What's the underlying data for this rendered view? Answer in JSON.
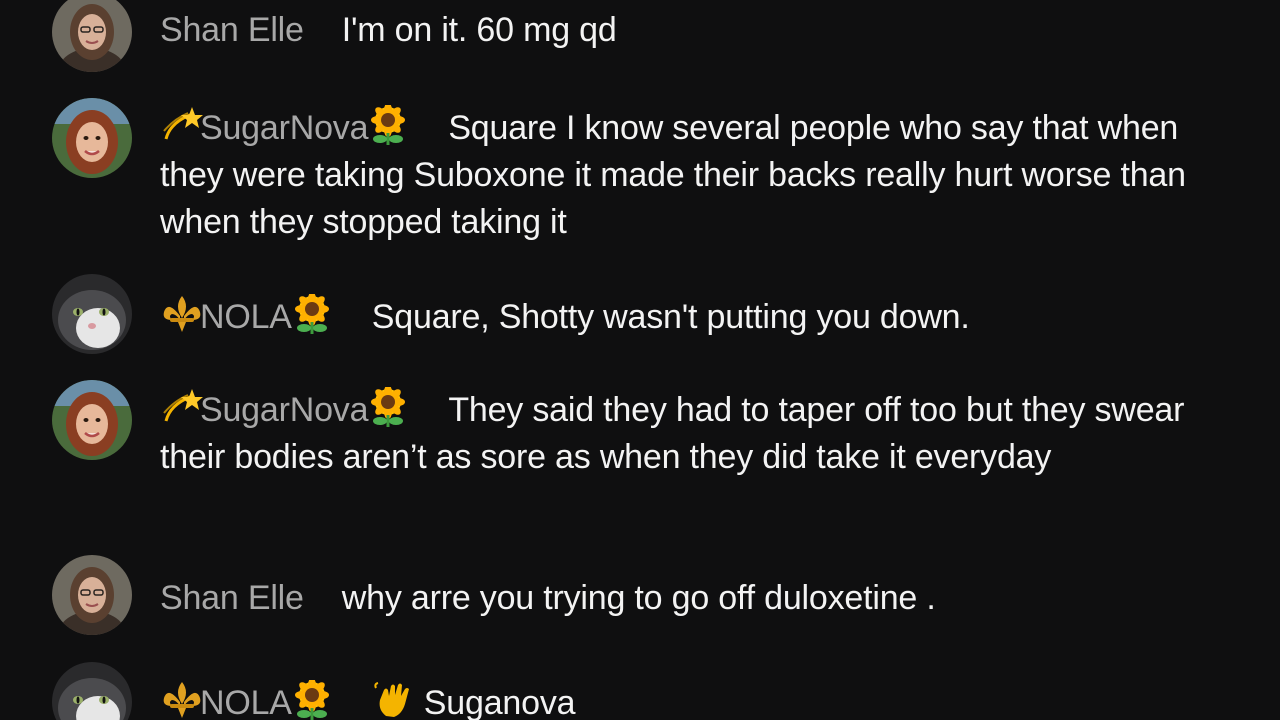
{
  "messages": [
    {
      "user": "Shan Elle",
      "text": "I'm on it. 60 mg qd",
      "avatar": "woman-glasses-avatar",
      "lead_emoji": "",
      "tail_emoji": "",
      "msg_emoji": ""
    },
    {
      "user": "SugarNova",
      "text": "Square I know several people who say that when they were taking Suboxone it made their backs really hurt worse than when they stopped taking it",
      "avatar": "woman-selfie-avatar",
      "lead_emoji": "dizzy-star-icon",
      "tail_emoji": "sunflower-icon",
      "msg_emoji": ""
    },
    {
      "user": "NOLA",
      "text": "Square, Shotty wasn't putting you down.",
      "avatar": "cat-avatar",
      "lead_emoji": "fleur-de-lis-icon",
      "tail_emoji": "sunflower-icon",
      "msg_emoji": ""
    },
    {
      "user": "SugarNova",
      "text": "They said they had to taper off too but they swear their bodies aren’t as sore as when they did take it everyday",
      "avatar": "woman-selfie-avatar",
      "lead_emoji": "dizzy-star-icon",
      "tail_emoji": "sunflower-icon",
      "msg_emoji": ""
    },
    {
      "user": "Shan Elle",
      "text": "why arre you trying to go off duloxetine .",
      "avatar": "woman-glasses-avatar",
      "lead_emoji": "",
      "tail_emoji": "",
      "msg_emoji": ""
    },
    {
      "user": "NOLA",
      "text": "Suganova",
      "avatar": "cat-avatar",
      "lead_emoji": "fleur-de-lis-icon",
      "tail_emoji": "sunflower-icon",
      "msg_emoji": "waving-hand-icon"
    }
  ],
  "colors": {
    "background": "#0f0f10",
    "username": "#a8a8a8",
    "message": "#f3f3f3"
  }
}
